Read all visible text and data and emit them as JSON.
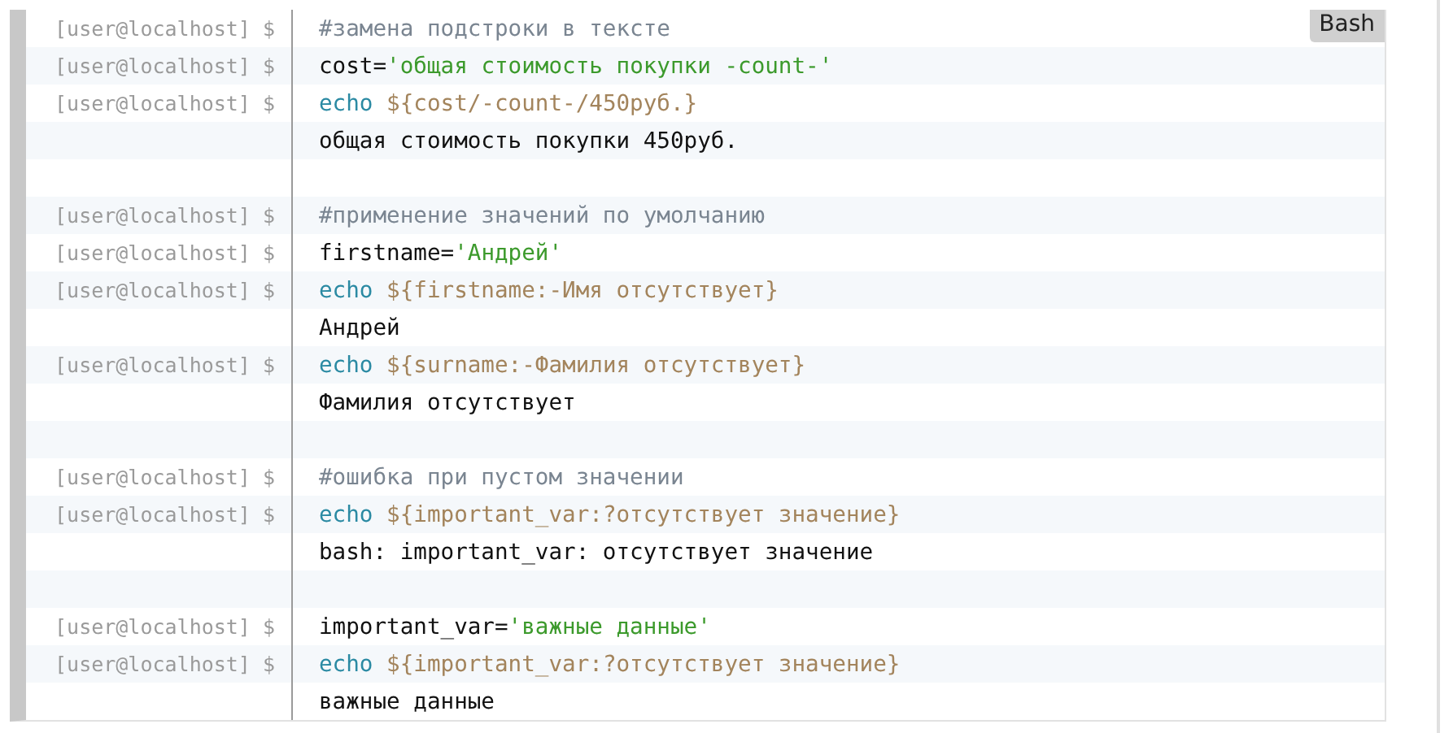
{
  "language_label": "Bash",
  "lines": [
    {
      "kind": "command",
      "prompt": "[user@localhost] $",
      "tokens": [
        {
          "kind": "comment",
          "text": "#замена подстроки в тексте"
        }
      ]
    },
    {
      "kind": "command",
      "prompt": "[user@localhost] $",
      "tokens": [
        {
          "kind": "plain",
          "text": "cost="
        },
        {
          "kind": "string",
          "text": "'общая стоимость покупки -count-'"
        }
      ]
    },
    {
      "kind": "command",
      "prompt": "[user@localhost] $",
      "tokens": [
        {
          "kind": "keyword",
          "text": "echo"
        },
        {
          "kind": "variable",
          "text": " ${cost/-count-/450руб.}"
        }
      ]
    },
    {
      "kind": "output",
      "tokens": [
        {
          "kind": "plain",
          "text": "общая стоимость покупки 450руб."
        }
      ]
    },
    {
      "kind": "blank"
    },
    {
      "kind": "command",
      "prompt": "[user@localhost] $",
      "tokens": [
        {
          "kind": "comment",
          "text": "#применение значений по умолчанию"
        }
      ]
    },
    {
      "kind": "command",
      "prompt": "[user@localhost] $",
      "tokens": [
        {
          "kind": "plain",
          "text": "firstname="
        },
        {
          "kind": "string",
          "text": "'Андрей'"
        }
      ]
    },
    {
      "kind": "command",
      "prompt": "[user@localhost] $",
      "tokens": [
        {
          "kind": "keyword",
          "text": "echo"
        },
        {
          "kind": "variable",
          "text": " ${firstname:-Имя отсутствует}"
        }
      ]
    },
    {
      "kind": "output",
      "tokens": [
        {
          "kind": "plain",
          "text": "Андрей"
        }
      ]
    },
    {
      "kind": "command",
      "prompt": "[user@localhost] $",
      "tokens": [
        {
          "kind": "keyword",
          "text": "echo"
        },
        {
          "kind": "variable",
          "text": " ${surname:-Фамилия отсутствует}"
        }
      ]
    },
    {
      "kind": "output",
      "tokens": [
        {
          "kind": "plain",
          "text": "Фамилия отсутствует"
        }
      ]
    },
    {
      "kind": "blank"
    },
    {
      "kind": "command",
      "prompt": "[user@localhost] $",
      "tokens": [
        {
          "kind": "comment",
          "text": "#ошибка при пустом значении"
        }
      ]
    },
    {
      "kind": "command",
      "prompt": "[user@localhost] $",
      "tokens": [
        {
          "kind": "keyword",
          "text": "echo"
        },
        {
          "kind": "variable",
          "text": " ${important_var:?отсутствует значение}"
        }
      ]
    },
    {
      "kind": "output",
      "tokens": [
        {
          "kind": "plain",
          "text": "bash: important_var: отсутствует значение"
        }
      ]
    },
    {
      "kind": "blank"
    },
    {
      "kind": "command",
      "prompt": "[user@localhost] $",
      "tokens": [
        {
          "kind": "plain",
          "text": "important_var="
        },
        {
          "kind": "string",
          "text": "'важные данные'"
        }
      ]
    },
    {
      "kind": "command",
      "prompt": "[user@localhost] $",
      "tokens": [
        {
          "kind": "keyword",
          "text": "echo"
        },
        {
          "kind": "variable",
          "text": " ${important_var:?отсутствует значение}"
        }
      ]
    },
    {
      "kind": "output",
      "tokens": [
        {
          "kind": "plain",
          "text": "важные данные"
        }
      ]
    }
  ]
}
